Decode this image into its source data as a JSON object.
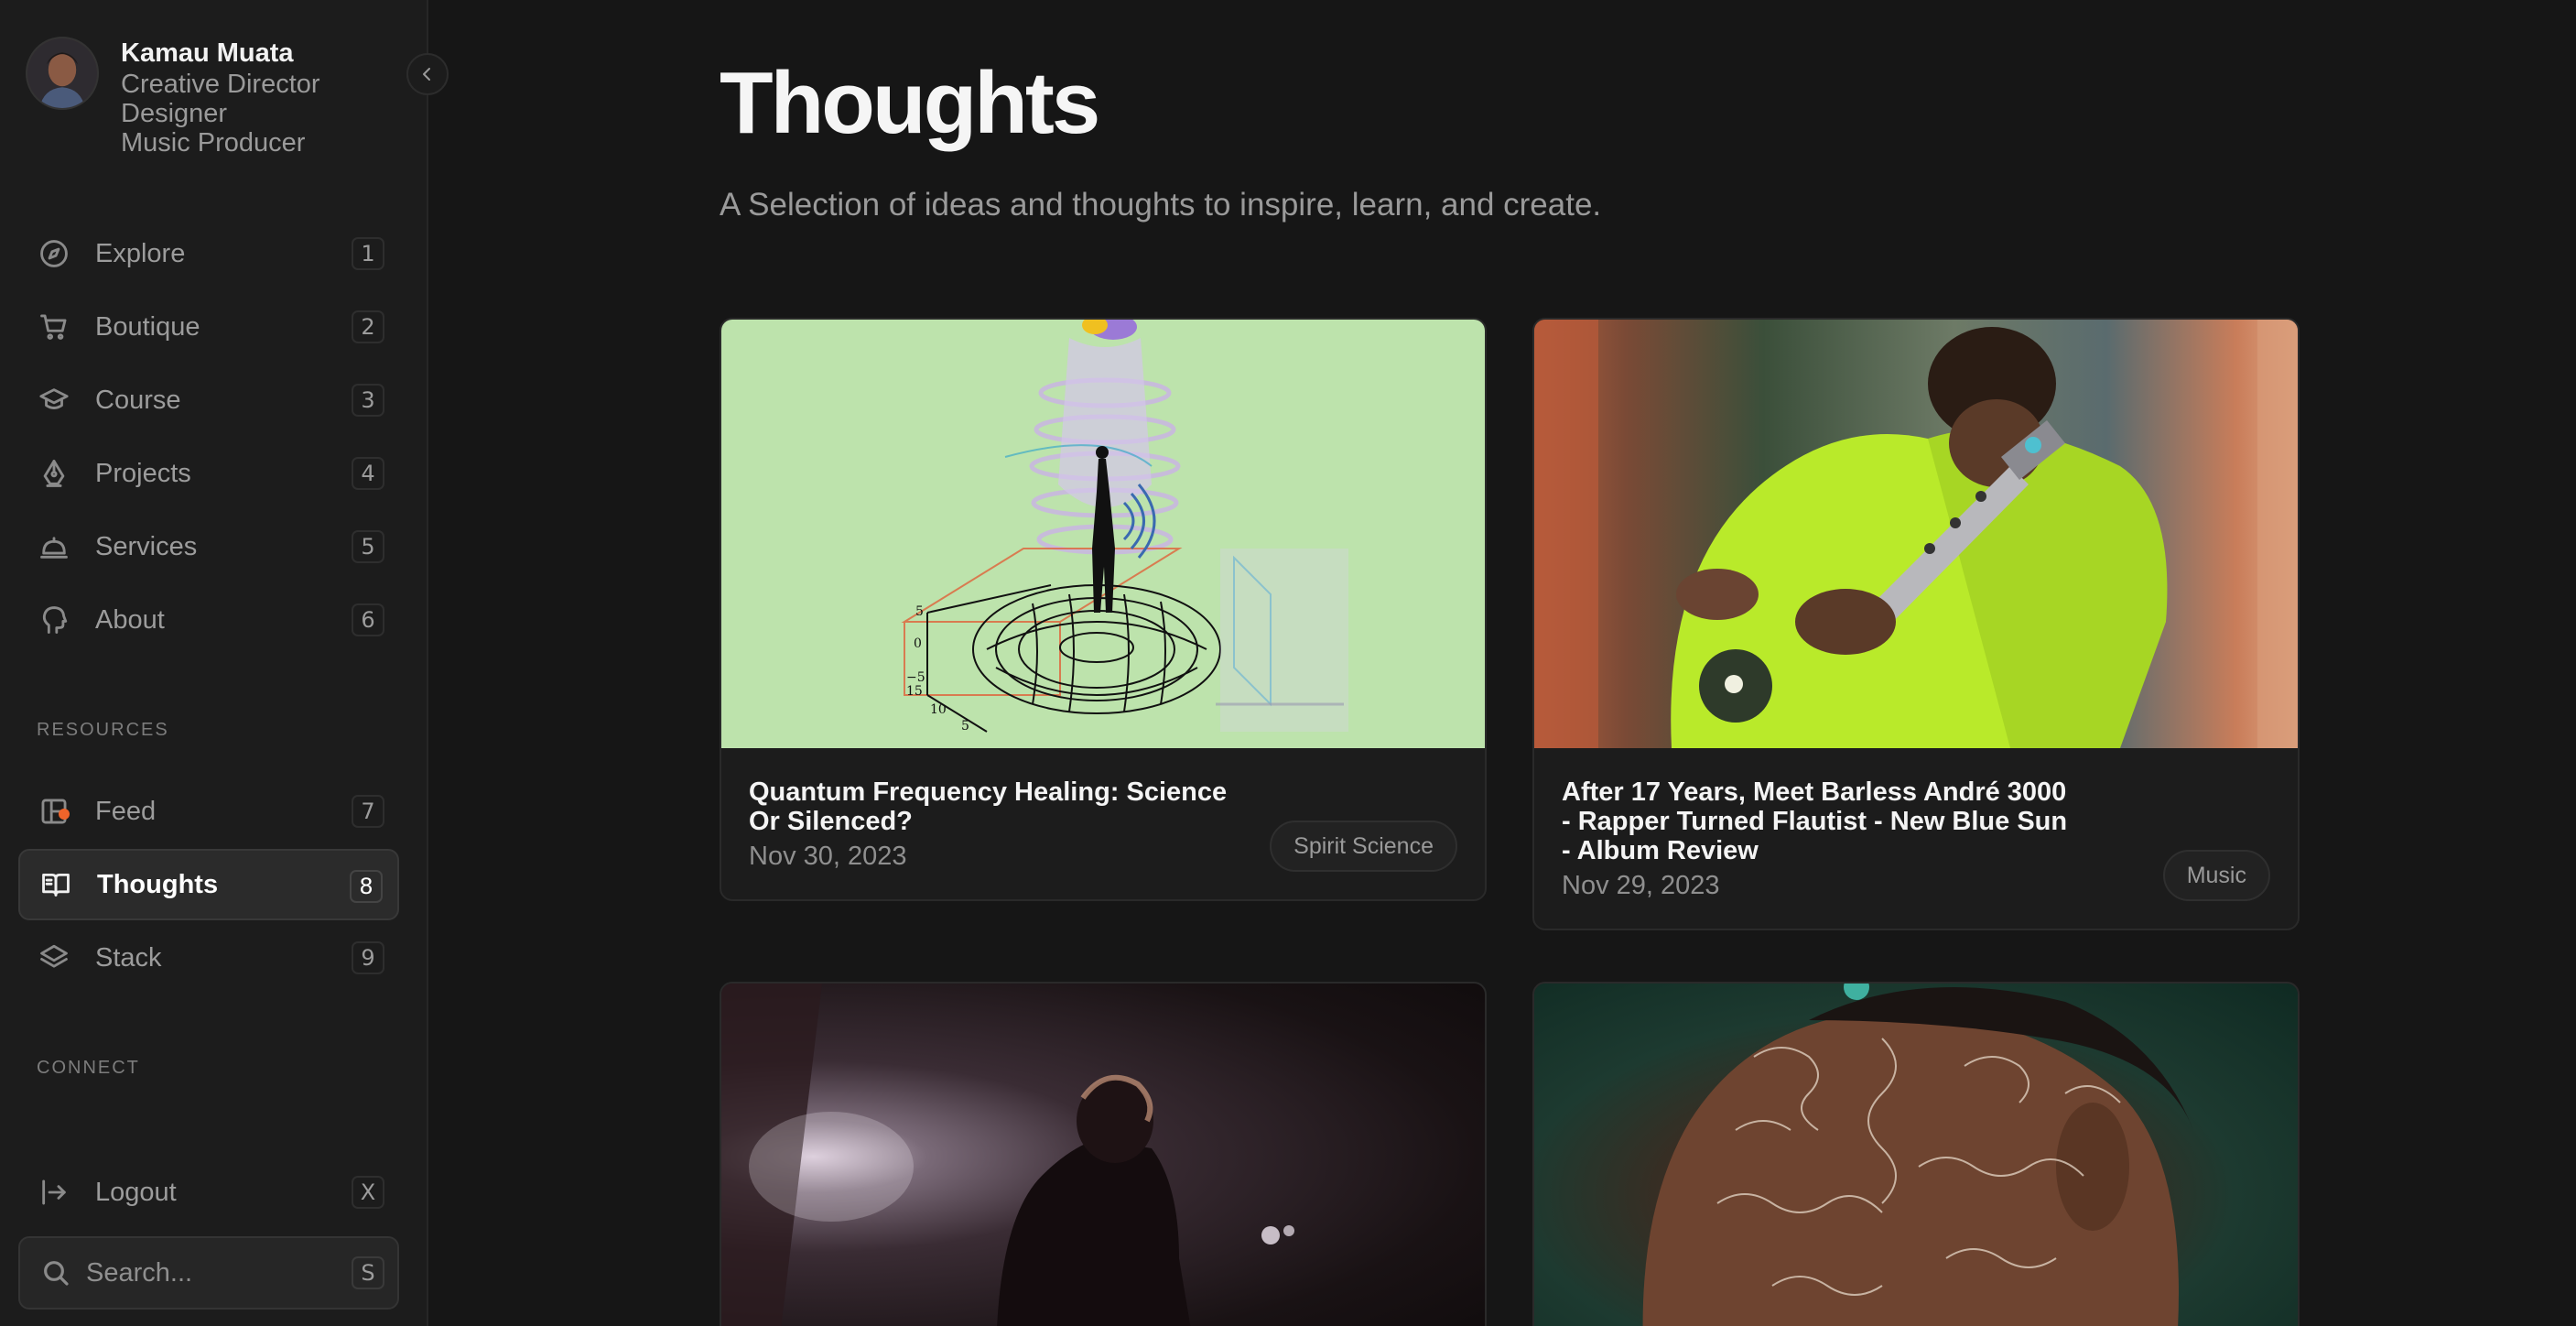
{
  "profile": {
    "name": "Kamau Muata",
    "roles": [
      "Creative Director",
      "Designer",
      "Music Producer"
    ]
  },
  "nav": {
    "primary": [
      {
        "label": "Explore",
        "key": "1",
        "icon": "compass-icon"
      },
      {
        "label": "Boutique",
        "key": "2",
        "icon": "cart-icon"
      },
      {
        "label": "Course",
        "key": "3",
        "icon": "graduation-cap-icon"
      },
      {
        "label": "Projects",
        "key": "4",
        "icon": "pen-nib-icon"
      },
      {
        "label": "Services",
        "key": "5",
        "icon": "service-bell-icon"
      },
      {
        "label": "About",
        "key": "6",
        "icon": "head-icon"
      }
    ],
    "resources_label": "RESOURCES",
    "resources": [
      {
        "label": "Feed",
        "key": "7",
        "icon": "feed-icon",
        "has_notification_dot": true
      },
      {
        "label": "Thoughts",
        "key": "8",
        "icon": "open-book-icon",
        "active": true
      },
      {
        "label": "Stack",
        "key": "9",
        "icon": "layers-icon"
      }
    ],
    "connect_label": "CONNECT",
    "logout": {
      "label": "Logout",
      "key": "X"
    },
    "search": {
      "placeholder": "Search...",
      "key": "S"
    }
  },
  "page": {
    "title": "Thoughts",
    "subtitle": "A Selection of ideas and thoughts to inspire, learn, and create."
  },
  "posts": [
    {
      "title": "Quantum Frequency Healing: Science Or Silenced?",
      "date": "Nov 30, 2023",
      "tag": "Spirit Science"
    },
    {
      "title": "After 17 Years, Meet Barless André 3000 - Rapper Turned Flautist - New Blue Sun - Album Review",
      "date": "Nov 29, 2023",
      "tag": "Music"
    },
    {
      "title": "",
      "date": "",
      "tag": ""
    },
    {
      "title": "",
      "date": "",
      "tag": ""
    }
  ],
  "colors": {
    "background": "#161616",
    "sidebar": "#1c1c1c",
    "notification_dot": "#f0642a",
    "quantum_art_bg": "#bde3ac"
  }
}
